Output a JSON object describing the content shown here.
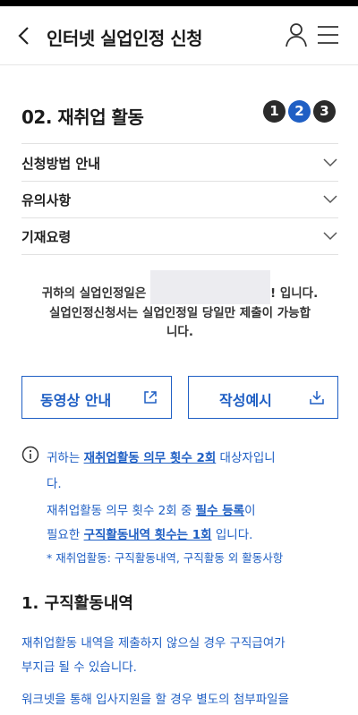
{
  "header": {
    "title": "인터넷 실업인정 신청"
  },
  "section": {
    "title": "02. 재취업 활동",
    "steps": [
      "1",
      "2",
      "3"
    ]
  },
  "accordion": [
    {
      "label": "신청방법 안내"
    },
    {
      "label": "유의사항"
    },
    {
      "label": "기재요령"
    }
  ],
  "notice": {
    "line1_prefix": "귀하의 실업인정일은",
    "line1_suffix": "입니다.",
    "line2": "실업인정신청서는 실업인정일 당일만 제출이 가능합",
    "line3": "니다."
  },
  "buttons": {
    "video": "동영상 안내",
    "sample": "작성예시"
  },
  "info": {
    "l1_a": "귀하는 ",
    "l1_b": "재취업활동 의무 횟수 2회",
    "l1_c": " 대상자입니",
    "l2": "다.",
    "l3_a": "재취업활동 의무 횟수 2회 중 ",
    "l3_b": "필수 등록",
    "l3_c": "이",
    "l4_a": "필요한 ",
    "l4_b": "구직활동내역 횟수는 1회",
    "l4_c": " 입니다.",
    "foot": "* 재취업활동: 구직활동내역, 구직활동 외 활동사항"
  },
  "job_search": {
    "title": "1. 구직활동내역",
    "p1": "재취업활동 내역을 제출하지 않으실 경우 구직급여가",
    "p2": "부지급 될 수 있습니다.",
    "p3": "워크넷을 통해 입사지원을 할 경우 별도의 첨부파일을"
  }
}
